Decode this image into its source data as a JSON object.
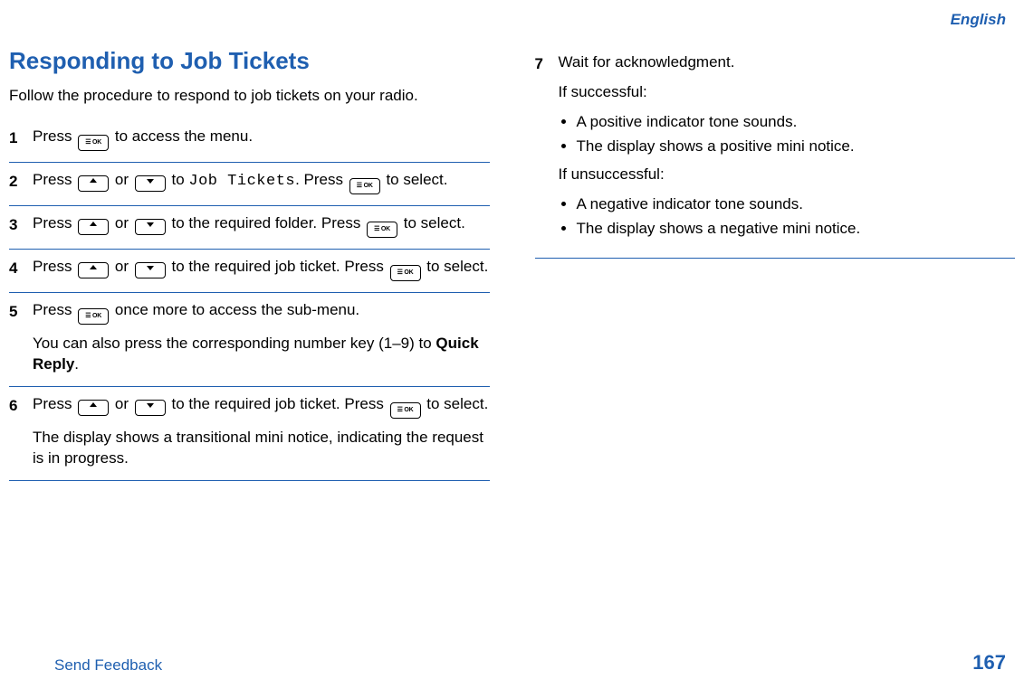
{
  "header_language": "English",
  "title": "Responding to Job Tickets",
  "intro": "Follow the procedure to respond to job tickets on your radio.",
  "mono_label": "Job Tickets",
  "quick_reply_label": "Quick Reply",
  "steps": {
    "s1": {
      "num": "1",
      "a": "Press ",
      "b": " to access the menu."
    },
    "s2": {
      "num": "2",
      "a": "Press ",
      "b": " or ",
      "c": " to ",
      "d": ". Press ",
      "e": " to select."
    },
    "s3": {
      "num": "3",
      "a": "Press ",
      "b": " or ",
      "c": " to the required folder. Press ",
      "d": " to select."
    },
    "s4": {
      "num": "4",
      "a": "Press ",
      "b": " or ",
      "c": " to the required job ticket. Press ",
      "d": " to select."
    },
    "s5": {
      "num": "5",
      "a": "Press ",
      "b": " once more to access the sub-menu.",
      "extra": "You can also press the corresponding number key (1–9) to "
    },
    "s6": {
      "num": "6",
      "a": "Press ",
      "b": " or ",
      "c": " to the required job ticket. Press ",
      "d": " to select.",
      "extra": "The display shows a transitional mini notice, indicating the request is in progress."
    },
    "s7": {
      "num": "7",
      "wait": "Wait for acknowledgment.",
      "success_label": "If successful:",
      "success_items": [
        "A positive indicator tone sounds.",
        "The display shows a positive mini notice."
      ],
      "fail_label": "If unsuccessful:",
      "fail_items": [
        "A negative indicator tone sounds.",
        "The display shows a negative mini notice."
      ]
    }
  },
  "footer": {
    "feedback": "Send Feedback",
    "page": "167"
  }
}
